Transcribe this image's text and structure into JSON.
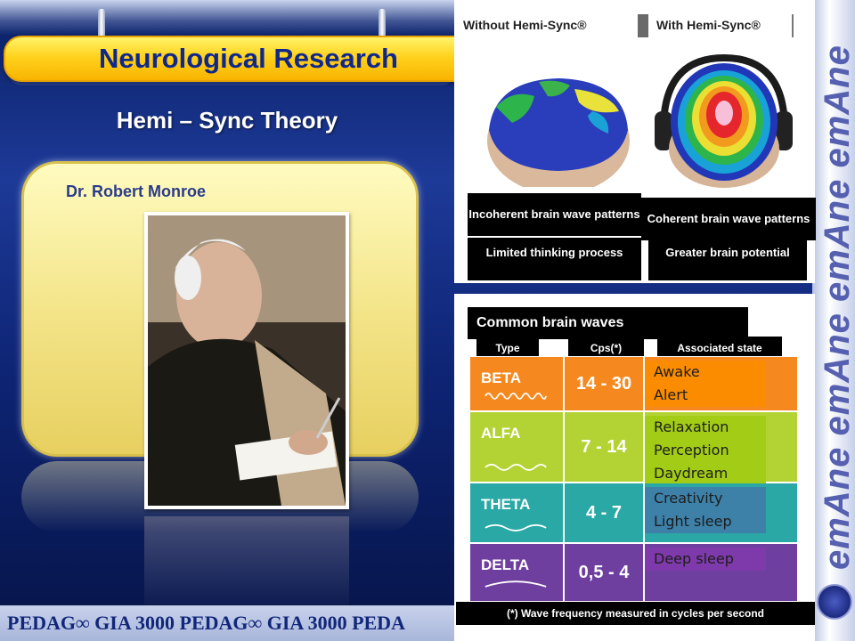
{
  "title": "Neurological Research",
  "subtitle": "Hemi – Sync Theory",
  "person_name": "Dr. Robert Monroe",
  "footer_brand": "PEDAG∞ GIA 3000 PEDAG∞ GIA 3000 PEDA",
  "side_brand": "emAne emAne emAne emAne",
  "comparison": {
    "without_label": "Without Hemi-Sync®",
    "with_label": "With Hemi-Sync®",
    "without_desc": "Incoherent brain wave patterns",
    "with_desc": "Coherent brain wave patterns",
    "without_result": "Limited thinking process",
    "with_result": "Greater brain potential"
  },
  "brain_waves": {
    "heading": "Common brain waves",
    "col_type": "Type",
    "col_cps": "Cps(*)",
    "col_state": "Associated state",
    "rows": [
      {
        "type": "BETA",
        "cps": "14 - 30",
        "state1": "Awake",
        "state2": "Alert",
        "state3": "",
        "color": "#f5891f",
        "state_color": "#fb8c00"
      },
      {
        "type": "ALFA",
        "cps": "7 - 14",
        "state1": "Relaxation",
        "state2": "Perception",
        "state3": "Daydream",
        "color": "#b3d334",
        "state_color": "#a3cc16"
      },
      {
        "type": "THETA",
        "cps": "4 - 7",
        "state1": "Creativity",
        "state2": "Light sleep",
        "state3": "",
        "color": "#2aa8a5",
        "state_color": "#3d80a8"
      },
      {
        "type": "DELTA",
        "cps": "0,5 - 4",
        "state1": "Deep sleep",
        "state2": "",
        "state3": "",
        "color": "#6f3fa0",
        "state_color": "#7e3aaa"
      }
    ],
    "footnote": "(*) Wave frequency measured in cycles per second"
  }
}
